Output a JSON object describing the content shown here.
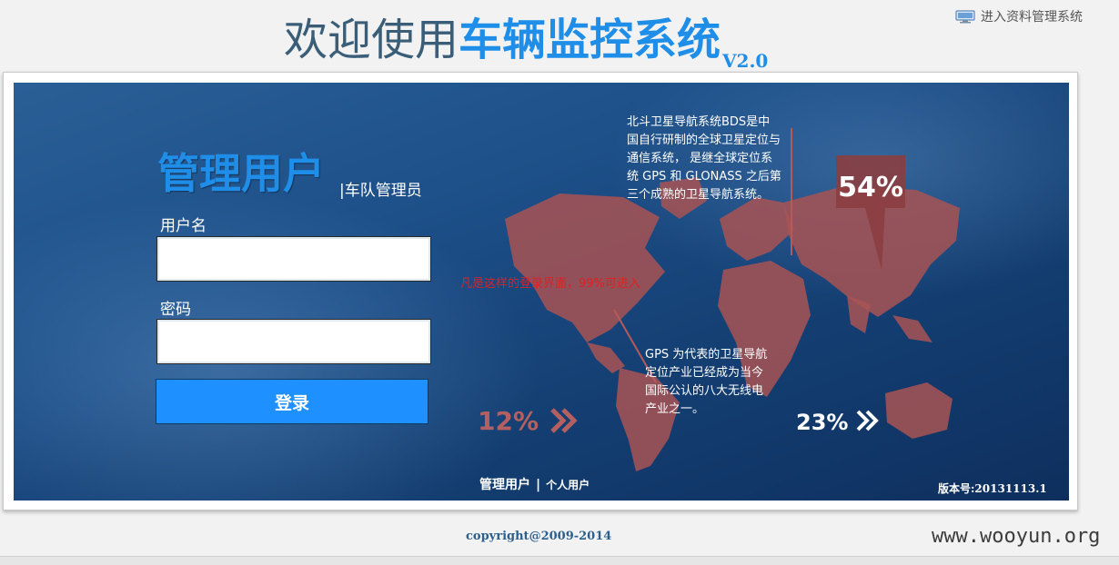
{
  "header": {
    "title_prefix": "欢迎使用",
    "title_highlight": "车辆监控系统",
    "version_tag": "V2.0",
    "top_link": "进入资料管理系统"
  },
  "login": {
    "panel_title": "管理用户",
    "panel_subtitle": "|车队管理员",
    "username_label": "用户名",
    "username_value": "",
    "password_label": "密码",
    "password_value": "",
    "submit_label": "登录"
  },
  "banner": {
    "hint_text": "凡是这样的登录界面，99%可进入",
    "stat_left": "12%",
    "stat_top": "54%",
    "stat_right": "23%",
    "text_block_1": "北斗卫星导航系统BDS是中国自行研制的全球卫星定位与通信系统， 是继全球定位系统 GPS 和 GLONASS 之后第三个成熟的卫星导航系统。",
    "text_block_2": "GPS 为代表的卫星导航定位产业已经成为当今国际公认的八大无线电产业之一。"
  },
  "bottom_tabs": {
    "tab_admin": "管理用户",
    "separator": "|",
    "tab_personal": "个人用户"
  },
  "version_text": "版本号:20131113.1",
  "footer": {
    "copyright": "copyright@2009-2014",
    "watermark": "www.wooyun.org"
  },
  "colors": {
    "brand_blue": "#1e8ee8",
    "title_dark": "#3a5d78",
    "map_fill": "#a85353",
    "hint_red": "#e02020"
  },
  "icons": {
    "top_link_icon": "monitor-icon",
    "arrow_icon": "double-chevron-right-icon"
  }
}
